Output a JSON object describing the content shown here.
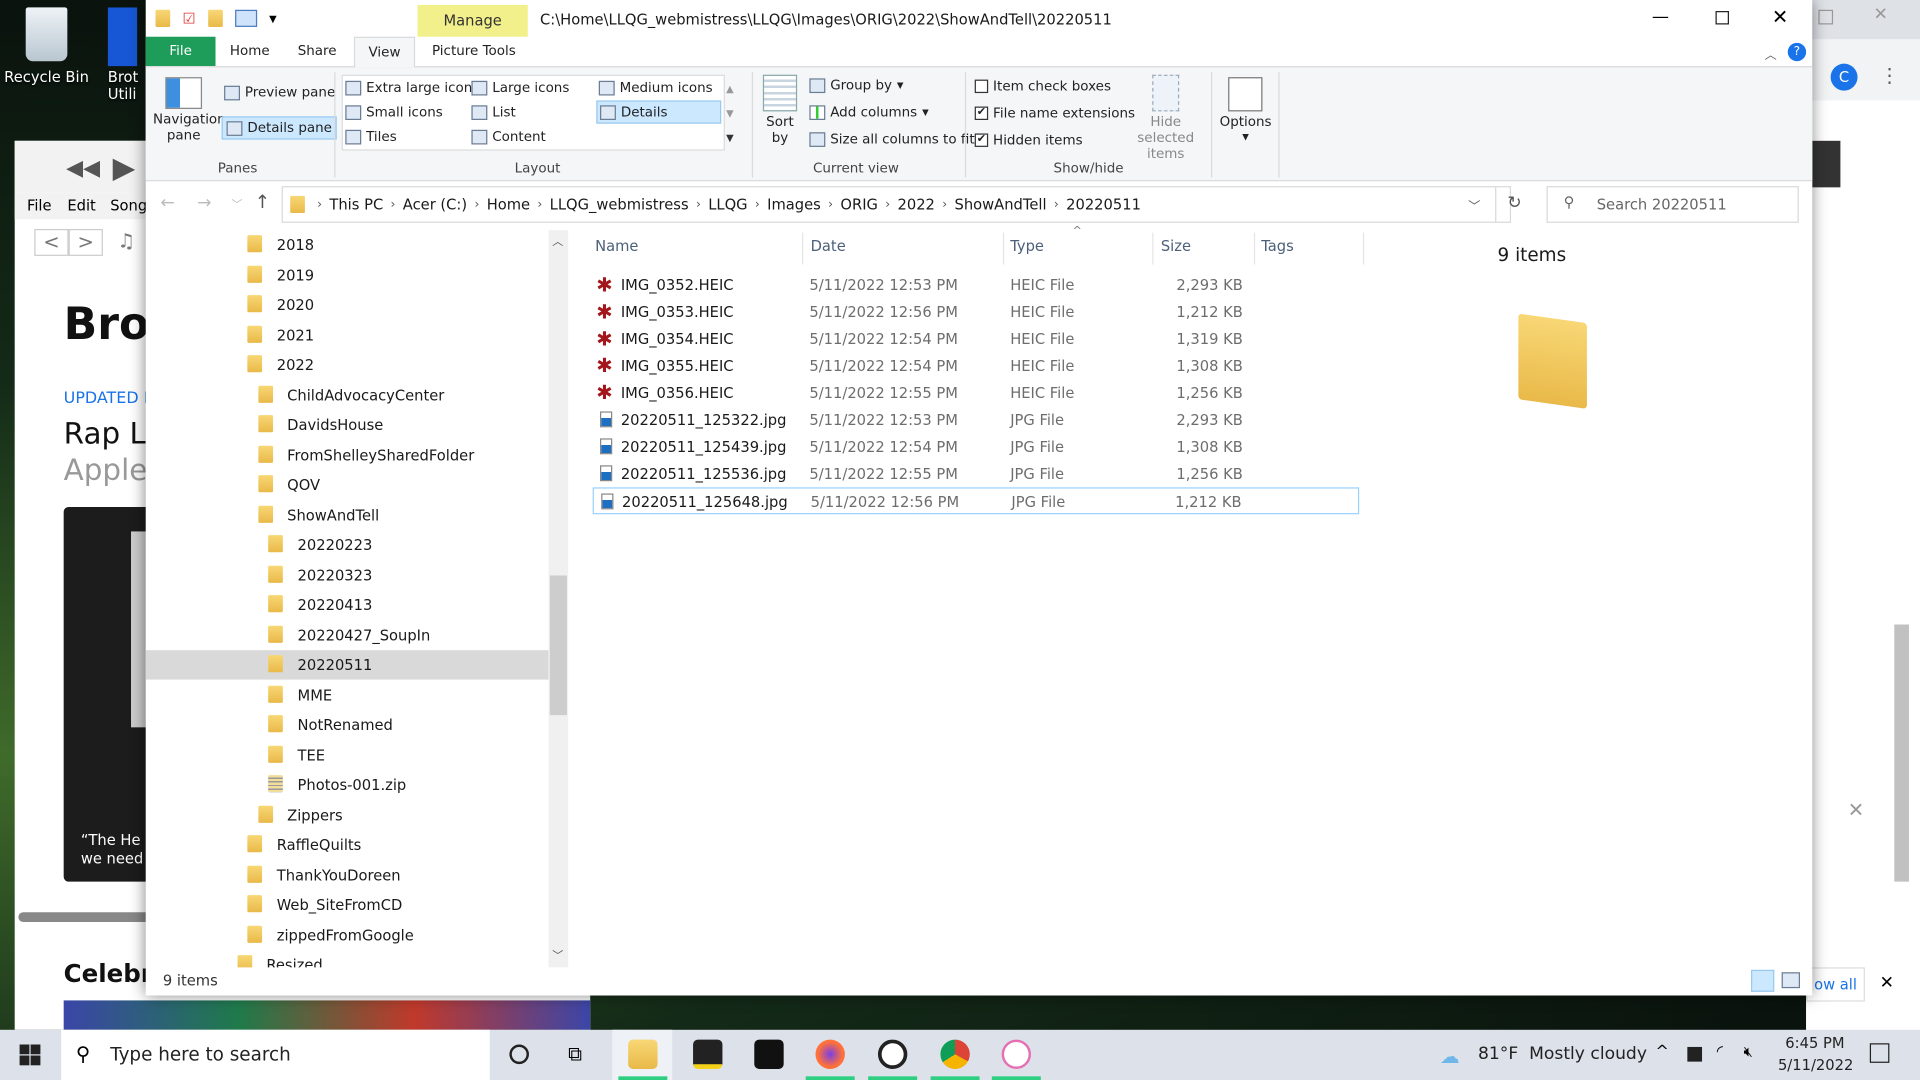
{
  "desktop": {
    "icons": [
      {
        "label": "Recycle Bin",
        "icon": "recycle-bin-icon"
      },
      {
        "label": "Brot Utili",
        "icon": "brother-utilities-icon"
      }
    ]
  },
  "background_app": {
    "menu": [
      "File",
      "Edit",
      "Song"
    ],
    "heading": "Brow",
    "updated": "UPDATED F",
    "title1": "Rap Li",
    "title2": "Apple",
    "quote1": "“The He",
    "quote2": "we need",
    "section": "Celebra"
  },
  "explorer": {
    "title_path": "C:\\Home\\LLQG_webmistress\\LLQG\\Images\\ORIG\\2022\\ShowAndTell\\20220511",
    "contextual_tab": "Manage",
    "contextual_sub": "Picture Tools",
    "tabs": [
      "File",
      "Home",
      "Share",
      "View"
    ],
    "ribbon": {
      "panes": {
        "navigation_pane": "Navigation pane",
        "preview_pane": "Preview pane",
        "details_pane": "Details pane",
        "group": "Panes"
      },
      "layout": {
        "items": [
          "Extra large icons",
          "Large icons",
          "Medium icons",
          "Small icons",
          "List",
          "Details",
          "Tiles",
          "Content"
        ],
        "selected": "Details",
        "group": "Layout"
      },
      "current_view": {
        "sort_by": "Sort by",
        "group_by": "Group by",
        "add_columns": "Add columns",
        "size_all": "Size all columns to fit",
        "group": "Current view"
      },
      "show_hide": {
        "item_check_boxes": {
          "label": "Item check boxes",
          "checked": false
        },
        "file_name_extensions": {
          "label": "File name extensions",
          "checked": true
        },
        "hidden_items": {
          "label": "Hidden items",
          "checked": true
        },
        "hide_selected": "Hide selected items",
        "group": "Show/hide"
      },
      "options": "Options"
    },
    "breadcrumb": [
      "This PC",
      "Acer (C:)",
      "Home",
      "LLQG_webmistress",
      "LLQG",
      "Images",
      "ORIG",
      "2022",
      "ShowAndTell",
      "20220511"
    ],
    "search_placeholder": "Search 20220511",
    "tree": [
      {
        "label": "2018",
        "level": 0
      },
      {
        "label": "2019",
        "level": 0
      },
      {
        "label": "2020",
        "level": 0
      },
      {
        "label": "2021",
        "level": 0
      },
      {
        "label": "2022",
        "level": 0
      },
      {
        "label": "ChildAdvocacyCenter",
        "level": 1
      },
      {
        "label": "DavidsHouse",
        "level": 1
      },
      {
        "label": "FromShelleySharedFolder",
        "level": 1
      },
      {
        "label": "QOV",
        "level": 1
      },
      {
        "label": "ShowAndTell",
        "level": 1
      },
      {
        "label": "20220223",
        "level": 2
      },
      {
        "label": "20220323",
        "level": 2
      },
      {
        "label": "20220413",
        "level": 2
      },
      {
        "label": "20220427_SoupIn",
        "level": 2
      },
      {
        "label": "20220511",
        "level": 2,
        "selected": true
      },
      {
        "label": "MME",
        "level": 2
      },
      {
        "label": "NotRenamed",
        "level": 2
      },
      {
        "label": "TEE",
        "level": 2
      },
      {
        "label": "Photos-001.zip",
        "level": 2,
        "zip": true
      },
      {
        "label": "Zippers",
        "level": 1
      },
      {
        "label": "RaffleQuilts",
        "level": 0
      },
      {
        "label": "ThankYouDoreen",
        "level": 0
      },
      {
        "label": "Web_SiteFromCD",
        "level": 0
      },
      {
        "label": "zippedFromGoogle",
        "level": 0
      },
      {
        "label": "Resized",
        "level": -1
      }
    ],
    "columns": [
      "Name",
      "Date",
      "Type",
      "Size",
      "Tags"
    ],
    "files": [
      {
        "name": "IMG_0352.HEIC",
        "date": "5/11/2022 12:53 PM",
        "type": "HEIC File",
        "size": "2,293 KB",
        "kind": "heic"
      },
      {
        "name": "IMG_0353.HEIC",
        "date": "5/11/2022 12:56 PM",
        "type": "HEIC File",
        "size": "1,212 KB",
        "kind": "heic"
      },
      {
        "name": "IMG_0354.HEIC",
        "date": "5/11/2022 12:54 PM",
        "type": "HEIC File",
        "size": "1,319 KB",
        "kind": "heic"
      },
      {
        "name": "IMG_0355.HEIC",
        "date": "5/11/2022 12:54 PM",
        "type": "HEIC File",
        "size": "1,308 KB",
        "kind": "heic"
      },
      {
        "name": "IMG_0356.HEIC",
        "date": "5/11/2022 12:55 PM",
        "type": "HEIC File",
        "size": "1,256 KB",
        "kind": "heic"
      },
      {
        "name": "20220511_125322.jpg",
        "date": "5/11/2022 12:53 PM",
        "type": "JPG File",
        "size": "2,293 KB",
        "kind": "jpg"
      },
      {
        "name": "20220511_125439.jpg",
        "date": "5/11/2022 12:54 PM",
        "type": "JPG File",
        "size": "1,308 KB",
        "kind": "jpg"
      },
      {
        "name": "20220511_125536.jpg",
        "date": "5/11/2022 12:55 PM",
        "type": "JPG File",
        "size": "1,256 KB",
        "kind": "jpg"
      },
      {
        "name": "20220511_125648.jpg",
        "date": "5/11/2022 12:56 PM",
        "type": "JPG File",
        "size": "1,212 KB",
        "kind": "jpg",
        "focused": true
      }
    ],
    "details_pane_count": "9 items",
    "status": "9 items"
  },
  "chrome": {
    "avatar": "C",
    "show_all": "ow all"
  },
  "taskbar": {
    "search_placeholder": "Type here to search",
    "weather": "81°F  Mostly cloudy",
    "time": "6:45 PM",
    "date": "5/11/2022"
  },
  "colors": {
    "file_tab": "#1e9c5a",
    "manage_tab": "#f2f08a",
    "selection": "#cce8ff",
    "taskbar": "#dde2ea"
  }
}
